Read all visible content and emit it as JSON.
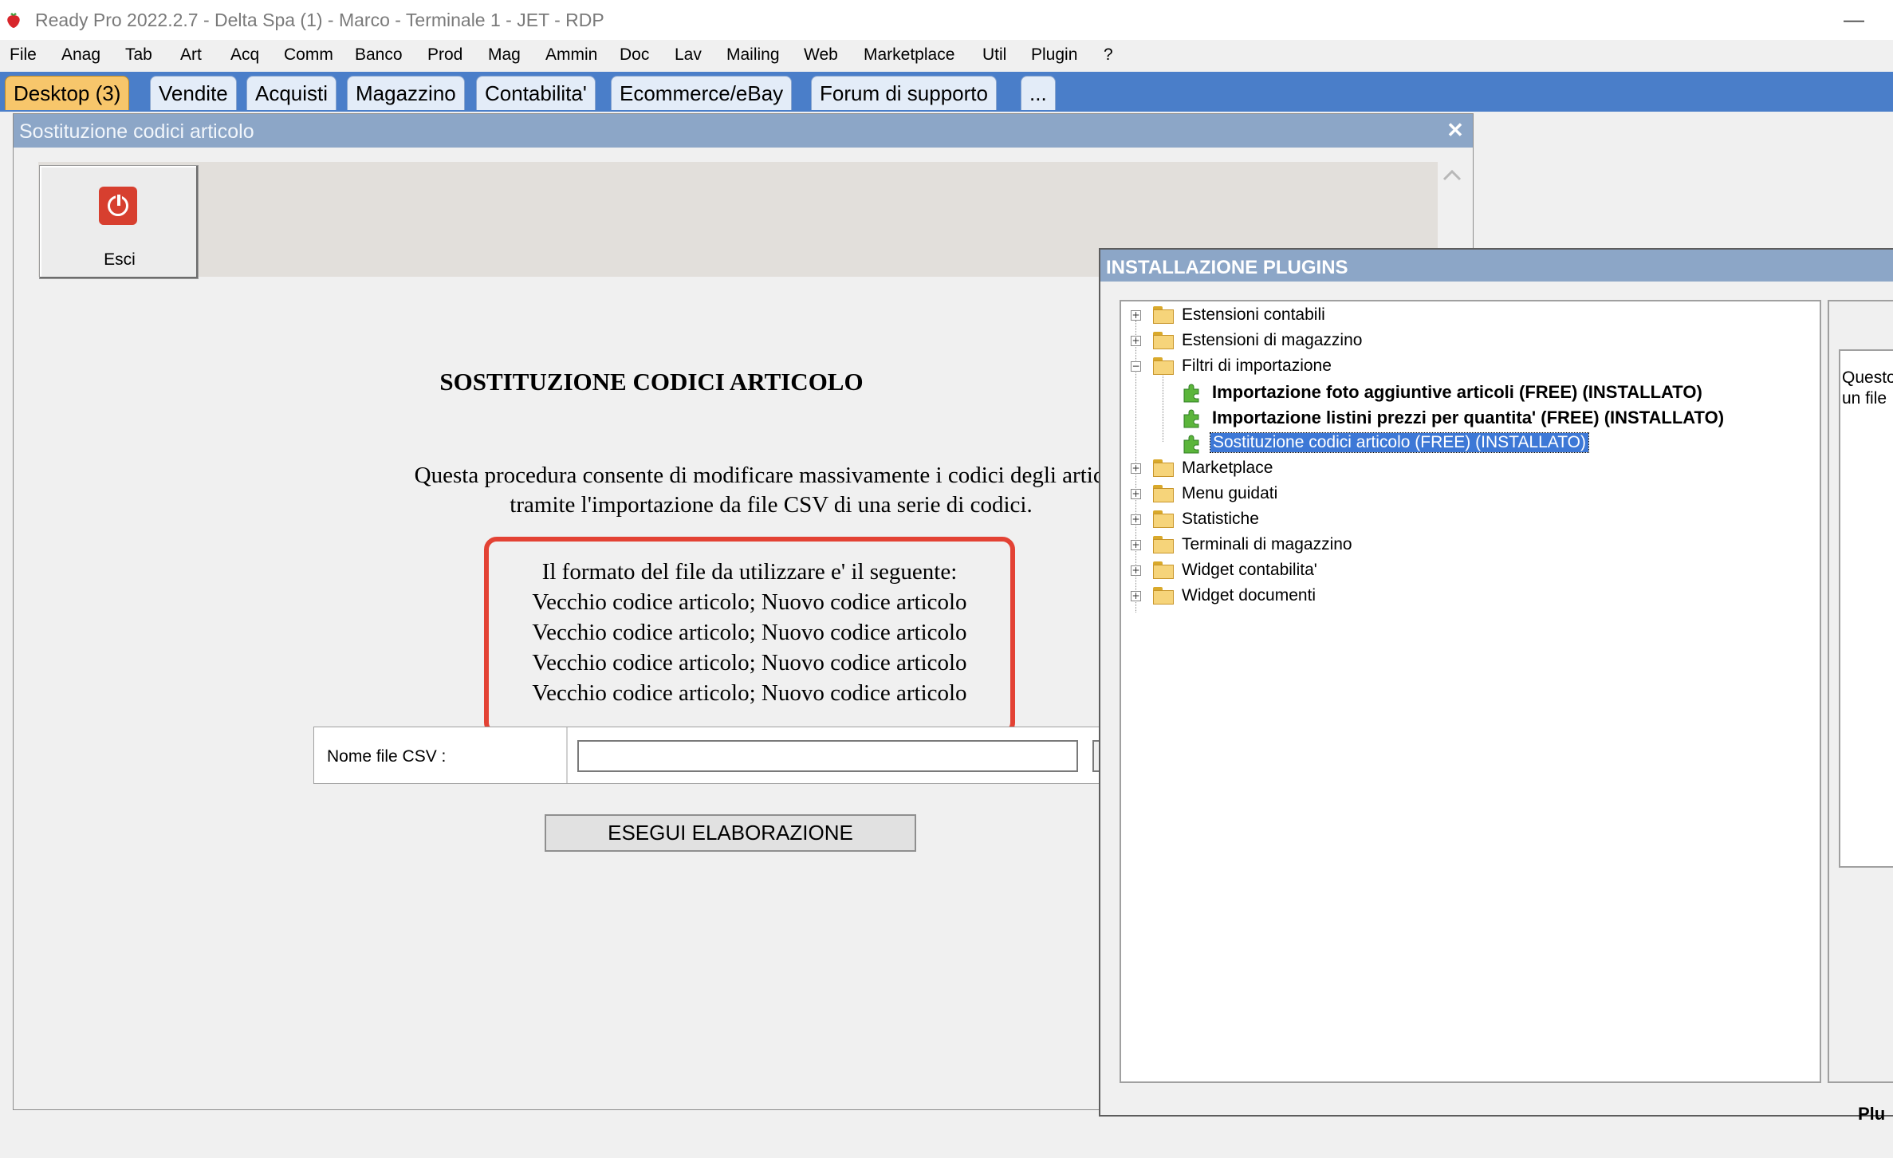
{
  "titlebar": {
    "title": "Ready Pro 2022.2.7 - Delta Spa (1) - Marco - Terminale 1 - JET - RDP",
    "minimize_glyph": "—",
    "icon": "strawberry-app-icon"
  },
  "menubar": {
    "items": [
      "File",
      "Anag",
      "Tab",
      "Art",
      "Acq",
      "Comm",
      "Banco",
      "Prod",
      "Mag",
      "Ammin",
      "Doc",
      "Lav",
      "Mailing",
      "Web",
      "Marketplace",
      "Util",
      "Plugin",
      "?"
    ]
  },
  "tabs": {
    "items": [
      "Desktop (3)",
      "Vendite",
      "Acquisti",
      "Magazzino",
      "Contabilita'",
      "Ecommerce/eBay",
      "Forum di supporto",
      "..."
    ],
    "active": "Desktop (3)",
    "active_color": "#f7c66b",
    "bar_color": "#4a7ec9"
  },
  "main_window": {
    "title": "Sostituzione codici articolo",
    "close_glyph": "✕",
    "exit_button": {
      "label": "Esci",
      "icon": "power-icon"
    },
    "heading": "SOSTITUZIONE CODICI ARTICOLO",
    "description": [
      "Questa procedura consente di modificare massivamente i codici degli articoli",
      "tramite l'importazione da file CSV di una serie di codici."
    ],
    "format_intro": "Il formato del file da utilizzare e' il seguente:",
    "format_lines": [
      "Vecchio codice articolo; Nuovo codice articolo",
      "Vecchio codice articolo; Nuovo codice articolo",
      "Vecchio codice articolo; Nuovo codice articolo",
      "Vecchio codice articolo; Nuovo codice articolo"
    ],
    "highlight_color": "#e34234",
    "csv_label": "Nome file CSV :",
    "csv_value": "",
    "run_button": "ESEGUI ELABORAZIONE"
  },
  "plugin_window": {
    "title": "INSTALLAZIONE PLUGINS",
    "tree": [
      {
        "label": "Estensioni contabili",
        "expander": "+"
      },
      {
        "label": "Estensioni di magazzino",
        "expander": "+"
      },
      {
        "label": "Filtri di importazione",
        "expander": "−"
      },
      {
        "label": "Importazione foto aggiuntive articoli (FREE) (INSTALLATO)"
      },
      {
        "label": "Importazione listini prezzi per quantita' (FREE) (INSTALLATO)"
      },
      {
        "label": "Sostituzione codici articolo (FREE) (INSTALLATO)"
      },
      {
        "label": "Marketplace",
        "expander": "+"
      },
      {
        "label": "Menu guidati",
        "expander": "+"
      },
      {
        "label": "Statistiche",
        "expander": "+"
      },
      {
        "label": "Terminali di magazzino",
        "expander": "+"
      },
      {
        "label": "Widget contabilita'",
        "expander": "+"
      },
      {
        "label": "Widget documenti",
        "expander": "+"
      }
    ],
    "selected": "Sostituzione codici articolo (FREE) (INSTALLATO)",
    "side_text": [
      "Questo",
      "un file"
    ],
    "side_bottom": "Plu"
  }
}
